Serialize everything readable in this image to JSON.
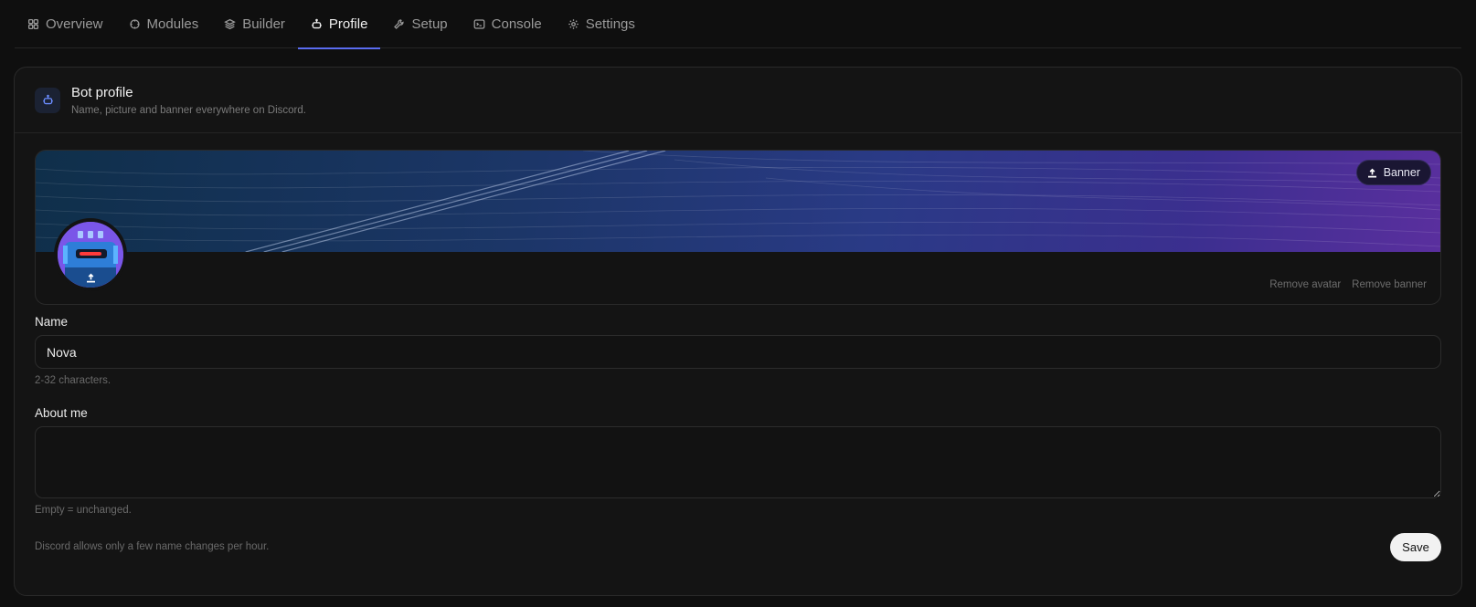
{
  "tabs": [
    {
      "label": "Overview",
      "icon": "grid-icon"
    },
    {
      "label": "Modules",
      "icon": "puzzle-icon"
    },
    {
      "label": "Builder",
      "icon": "layers-icon"
    },
    {
      "label": "Profile",
      "icon": "bot-icon",
      "active": true
    },
    {
      "label": "Setup",
      "icon": "wrench-icon"
    },
    {
      "label": "Console",
      "icon": "terminal-icon"
    },
    {
      "label": "Settings",
      "icon": "gear-icon"
    }
  ],
  "card": {
    "title": "Bot profile",
    "subtitle": "Name, picture and banner everywhere on Discord."
  },
  "banner": {
    "button_label": "Banner",
    "remove_avatar": "Remove avatar",
    "remove_banner": "Remove banner"
  },
  "name_field": {
    "label": "Name",
    "value": "Nova",
    "hint": "2-32 characters."
  },
  "about_field": {
    "label": "About me",
    "value": "",
    "hint": "Empty = unchanged."
  },
  "footer": {
    "note": "Discord allows only a few name changes per hour.",
    "save_label": "Save"
  },
  "colors": {
    "accent": "#5a6cf0",
    "background": "#0f0f0f",
    "card": "#141414"
  }
}
